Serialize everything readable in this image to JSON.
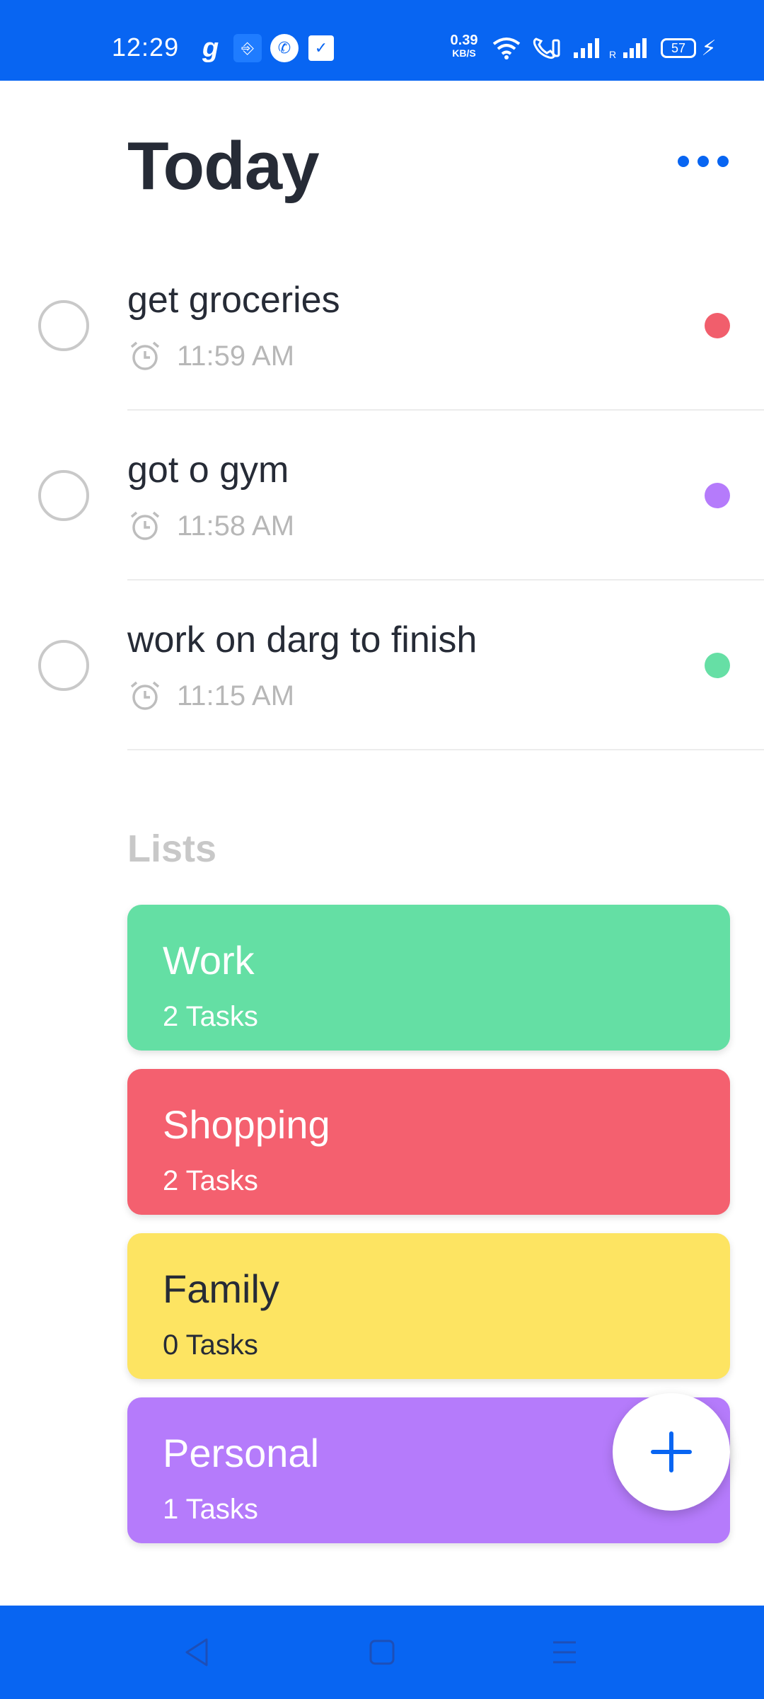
{
  "status_bar": {
    "time": "12:29",
    "network_speed_value": "0.39",
    "network_speed_unit": "KB/S",
    "battery_level": "57",
    "icons": [
      "g-app-icon",
      "usb-icon",
      "phone-call-icon",
      "check-task-icon",
      "wifi-icon",
      "wifi-calling-icon",
      "signal-icon",
      "roaming-signal-icon",
      "battery-icon",
      "charging-bolt-icon"
    ]
  },
  "header": {
    "title": "Today",
    "more_icon": "more-dots-icon"
  },
  "tasks": [
    {
      "title": "get groceries",
      "time": "11:59 AM",
      "color": "#F15E6C"
    },
    {
      "title": "got o gym",
      "time": "11:58 AM",
      "color": "#B57BFB"
    },
    {
      "title": "work on darg to finish",
      "time": "11:15 AM",
      "color": "#66DFA5"
    }
  ],
  "lists_section": {
    "heading": "Lists",
    "items": [
      {
        "name": "Work",
        "count": "2 Tasks",
        "color": "#64DFA4",
        "text_color": "#ffffff"
      },
      {
        "name": "Shopping",
        "count": "2 Tasks",
        "color": "#F4606F",
        "text_color": "#ffffff"
      },
      {
        "name": "Family",
        "count": "0 Tasks",
        "color": "#FDE462",
        "text_color": "#262B36"
      },
      {
        "name": "Personal",
        "count": "1 Tasks",
        "color": "#B57BFB",
        "text_color": "#ffffff"
      }
    ]
  },
  "fab": {
    "icon": "plus-icon",
    "color": "#0865F2"
  },
  "nav_bar": {
    "icons": [
      "back-icon",
      "home-icon",
      "recents-icon"
    ]
  },
  "colors": {
    "accent": "#0865F2",
    "title_text": "#262B36",
    "muted_text": "#b7b7b7"
  }
}
